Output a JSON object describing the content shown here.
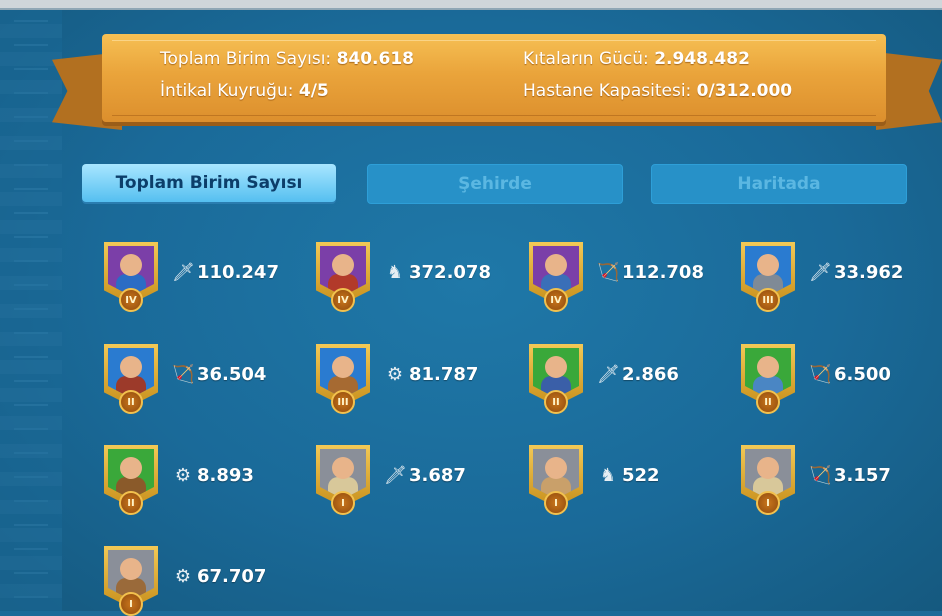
{
  "header": {
    "total_units_label": "Toplam Birim Sayısı:",
    "total_units_value": "840.618",
    "march_queue_label": "İntikal Kuyruğu:",
    "march_queue_value": "4/5",
    "power_label": "Kıtaların Gücü:",
    "power_value": "2.948.482",
    "hospital_label": "Hastane Kapasitesi:",
    "hospital_value": "0/312.000"
  },
  "tabs": [
    {
      "label": "Toplam Birim Sayısı",
      "active": true
    },
    {
      "label": "Şehirde",
      "active": false
    },
    {
      "label": "Haritada",
      "active": false
    }
  ],
  "units": [
    {
      "count": "110.247",
      "type_icon": "sword-icon",
      "tier": "IV",
      "bg": "#7b3fa8",
      "body": "#2b6cc4"
    },
    {
      "count": "372.078",
      "type_icon": "horse-icon",
      "tier": "IV",
      "bg": "#7b3fa8",
      "body": "#b23a2a"
    },
    {
      "count": "112.708",
      "type_icon": "bow-icon",
      "tier": "IV",
      "bg": "#7b3fa8",
      "body": "#3a6fb8"
    },
    {
      "count": "33.962",
      "type_icon": "sword-icon",
      "tier": "III",
      "bg": "#2a7bd0",
      "body": "#7f8a96"
    },
    {
      "count": "36.504",
      "type_icon": "bow-icon",
      "tier": "II",
      "bg": "#2a7bd0",
      "body": "#9c3a2a"
    },
    {
      "count": "81.787",
      "type_icon": "siege-icon",
      "tier": "III",
      "bg": "#2a7bd0",
      "body": "#a66a32"
    },
    {
      "count": "2.866",
      "type_icon": "sword-icon",
      "tier": "II",
      "bg": "#3aa83a",
      "body": "#3a5fa8"
    },
    {
      "count": "6.500",
      "type_icon": "bow-icon",
      "tier": "II",
      "bg": "#3aa83a",
      "body": "#4a86c4"
    },
    {
      "count": "8.893",
      "type_icon": "siege-icon",
      "tier": "II",
      "bg": "#3aa83a",
      "body": "#8a5a2a"
    },
    {
      "count": "3.687",
      "type_icon": "sword-icon",
      "tier": "I",
      "bg": "#8a8f99",
      "body": "#d8c89a"
    },
    {
      "count": "522",
      "type_icon": "horse-icon",
      "tier": "I",
      "bg": "#8a8f99",
      "body": "#c9a06a"
    },
    {
      "count": "3.157",
      "type_icon": "bow-icon",
      "tier": "I",
      "bg": "#8a8f99",
      "body": "#d8c89a"
    },
    {
      "count": "67.707",
      "type_icon": "siege-icon",
      "tier": "I",
      "bg": "#8a8f99",
      "body": "#9a6a3a"
    }
  ],
  "icon_glyphs": {
    "sword-icon": "🗡",
    "horse-icon": "♞",
    "bow-icon": "🏹",
    "siege-icon": "⚙"
  },
  "colors": {
    "panel_bg": "#1c6a98",
    "ribbon": "#eaa43b",
    "active_tab": "#55bff0",
    "inactive_tab": "#2791c8"
  }
}
